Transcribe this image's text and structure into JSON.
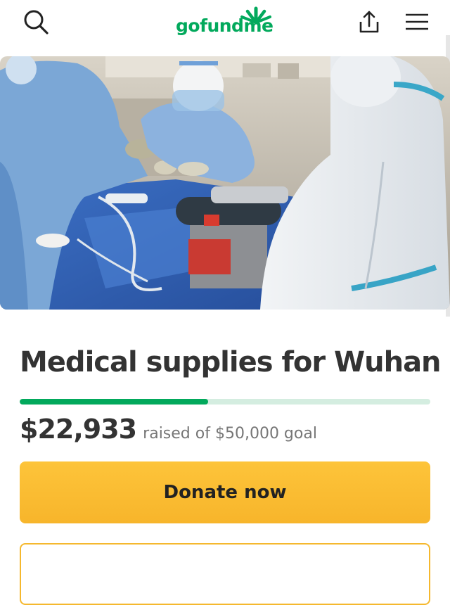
{
  "header": {
    "search_icon": "search-icon",
    "logo_text": "gofundme",
    "share_icon": "share-icon",
    "menu_icon": "hamburger-menu-icon"
  },
  "campaign": {
    "title": "Medical supplies for Wuhan",
    "raised_amount": "$22,933",
    "goal_text": "raised of $50,000 goal",
    "progress_fraction": 0.4587
  },
  "actions": {
    "donate_label": "Donate now"
  },
  "colors": {
    "brand_green": "#02a95c",
    "progress_track": "#d4ede0",
    "donate_yellow": "#fdc43a",
    "text_dark": "#333333",
    "text_muted": "#767676"
  }
}
